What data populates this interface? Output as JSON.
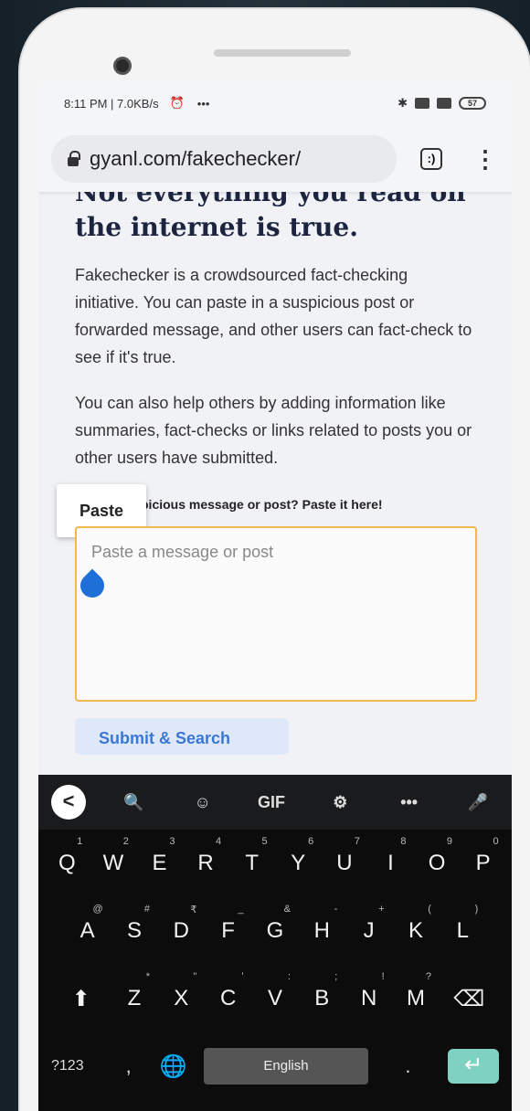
{
  "status_bar": {
    "time_info": "8:11 PM | 7.0KB/s",
    "more": "•••",
    "battery": "57"
  },
  "browser": {
    "url": "gyanl.com/fakechecker/",
    "tabs_count": ":)",
    "menu": "⋮"
  },
  "page": {
    "heading": "Not everything you read on the internet is true.",
    "para1": "Fakechecker is a crowdsourced fact-checking initiative. You can paste in a suspicious post or forwarded message, and other users can fact-check to see if it's true.",
    "para2": "You can also help others by adding information like summaries, fact-checks or links related to posts you or other users have submitted.",
    "callout": "picious message or post? Paste it here!",
    "textarea_placeholder": "Paste a message or post",
    "submit_label": "Submit & Search"
  },
  "paste_popup": {
    "label": "Paste"
  },
  "keyboard": {
    "toolbar": [
      "<",
      "🔍",
      "☺",
      "GIF",
      "⚙",
      "•••",
      "🎤"
    ],
    "row1": [
      {
        "key": "Q",
        "hint": "1"
      },
      {
        "key": "W",
        "hint": "2"
      },
      {
        "key": "E",
        "hint": "3"
      },
      {
        "key": "R",
        "hint": "4"
      },
      {
        "key": "T",
        "hint": "5"
      },
      {
        "key": "Y",
        "hint": "6"
      },
      {
        "key": "U",
        "hint": "7"
      },
      {
        "key": "I",
        "hint": "8"
      },
      {
        "key": "O",
        "hint": "9"
      },
      {
        "key": "P",
        "hint": "0"
      }
    ],
    "row2": [
      {
        "key": "A",
        "hint": "@"
      },
      {
        "key": "S",
        "hint": "#"
      },
      {
        "key": "D",
        "hint": "₹"
      },
      {
        "key": "F",
        "hint": "_"
      },
      {
        "key": "G",
        "hint": "&"
      },
      {
        "key": "H",
        "hint": "-"
      },
      {
        "key": "J",
        "hint": "+"
      },
      {
        "key": "K",
        "hint": "("
      },
      {
        "key": "L",
        "hint": ")"
      }
    ],
    "row3": [
      {
        "key": "⬆",
        "hint": ""
      },
      {
        "key": "Z",
        "hint": "*"
      },
      {
        "key": "X",
        "hint": "\""
      },
      {
        "key": "C",
        "hint": "'"
      },
      {
        "key": "V",
        "hint": ":"
      },
      {
        "key": "B",
        "hint": ";"
      },
      {
        "key": "N",
        "hint": "!"
      },
      {
        "key": "M",
        "hint": "?"
      },
      {
        "key": "⌫",
        "hint": ""
      }
    ],
    "bottom": {
      "symbols": "?123",
      "comma": ",",
      "space": "English",
      "period": ".",
      "enter": "↵"
    }
  }
}
